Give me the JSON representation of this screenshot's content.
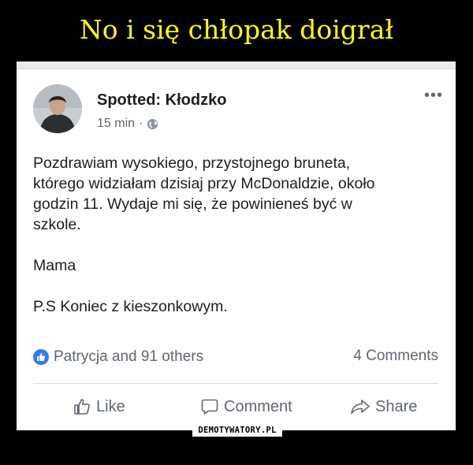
{
  "meme": {
    "title": "No i się chłopak doigrał",
    "watermark": "DEMOTYWATORY.PL"
  },
  "post": {
    "page_name": "Spotted: Kłodzko",
    "time": "15 min",
    "separator": "·",
    "privacy_icon": "globe-icon",
    "more_label": "•••",
    "body": {
      "line1": "Pozdrawiam wysokiego, przystojnego bruneta,",
      "line2": "którego widziałam dzisiaj przy McDonaldzie, około",
      "line3": "godzin 11. Wydaje mi się, że powinieneś być w",
      "line4": "szkole.",
      "signature": "Mama",
      "ps": "P.S Koniec z kieszonkowym."
    },
    "reactions": {
      "icon": "thumbs-up-icon",
      "text": "Patrycja and 91 others"
    },
    "comments_count": "4 Comments",
    "actions": {
      "like": "Like",
      "comment": "Comment",
      "share": "Share"
    }
  },
  "colors": {
    "background": "#000000",
    "title": "#ffff00",
    "card": "#ffffff",
    "text": "#1c1e21",
    "secondary_text": "#606770",
    "like_blue": "#2e7cf6",
    "divider": "#dadde1"
  }
}
